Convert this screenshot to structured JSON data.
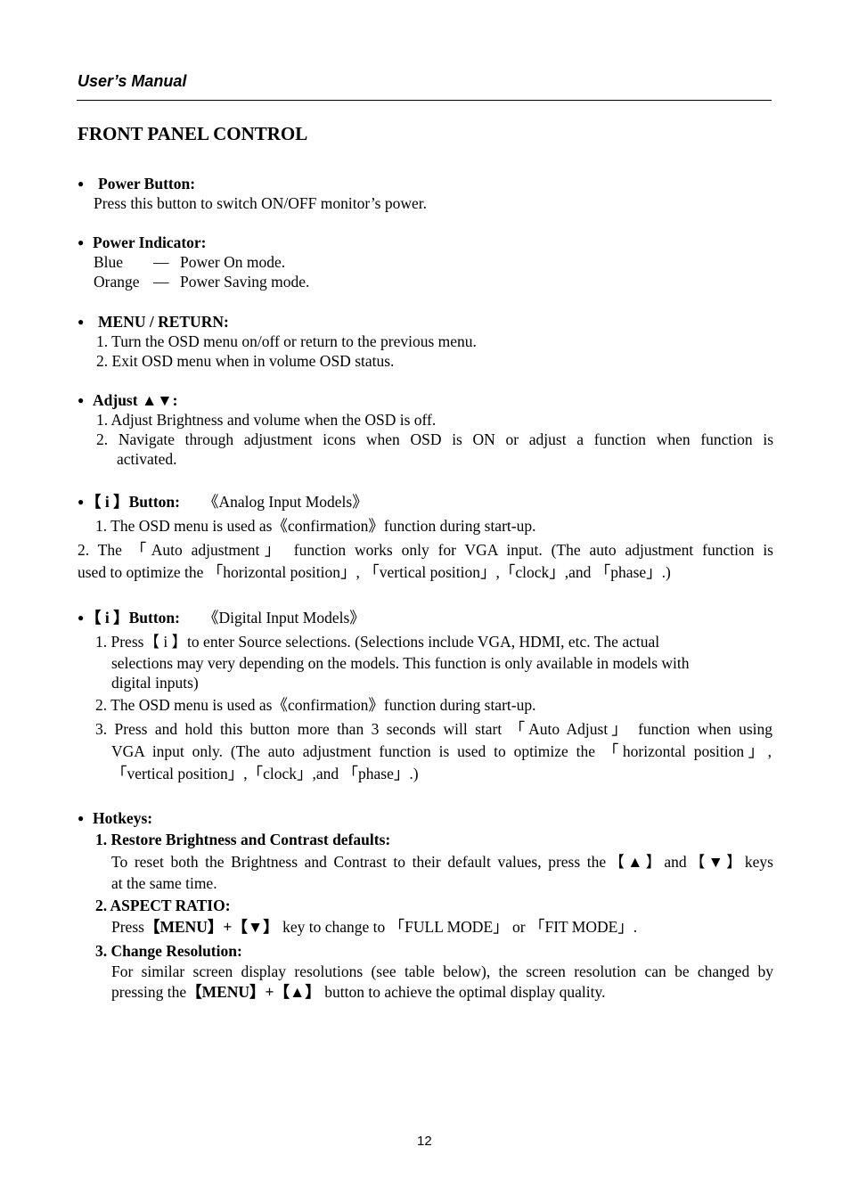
{
  "header": {
    "title": "User’s Manual"
  },
  "page_title": "FRONT PANEL CONTROL",
  "sections": {
    "power_button": {
      "heading": "Power Button:",
      "lines": [
        "Press this button to switch ON/OFF monitor’s power."
      ]
    },
    "power_indicator": {
      "heading": "Power Indicator:",
      "rows": [
        {
          "color": "Blue",
          "dash": "—",
          "mode": "Power On mode."
        },
        {
          "color": "Orange",
          "dash": "—",
          "mode": "Power Saving mode."
        }
      ]
    },
    "menu_return": {
      "heading": "MENU / RETURN:",
      "items": [
        "1. Turn the OSD menu on/off or return to the previous menu.",
        "2. Exit OSD menu when in volume OSD status."
      ]
    },
    "adjust": {
      "heading": "Adjust ▲▼:",
      "items": [
        "1. Adjust Brightness and volume when the OSD is off.",
        "2. Navigate through adjustment icons when OSD is ON or adjust a function when function is",
        "activated."
      ]
    },
    "i_button_analog": {
      "heading": "【 i 】Button:",
      "subtitle": "《Analog Input Models》",
      "items": [
        "1. The OSD menu is used as《confirmation》function during start-up.",
        "2. The 「Auto adjustment」 function works only for VGA input. (The auto adjustment function is",
        "used to optimize the 「horizontal position」, 「vertical position」,「clock」,and 「phase」.)"
      ]
    },
    "i_button_digital": {
      "heading": "【 i 】Button:",
      "subtitle": "《Digital Input Models》",
      "items": [
        "1. Press【 i 】to enter Source selections. (Selections include VGA, HDMI, etc. The actual",
        "selections may very depending on the models. This function is only available in models with",
        "digital inputs)",
        "2. The OSD menu is used as《confirmation》function during start-up.",
        "3. Press and hold this button more than 3 seconds will start 「Auto Adjust」 function when using",
        "VGA input only. (The auto adjustment function is used to optimize the 「horizontal position」,",
        "「vertical position」,「clock」,and 「phase」.)"
      ]
    },
    "hotkeys": {
      "heading": "Hotkeys:",
      "restore": {
        "heading": "1. Restore Brightness and Contrast defaults:",
        "lines": [
          "To reset both the Brightness and Contrast to their default values, press the【▲】and【▼】keys",
          "at the same time."
        ]
      },
      "aspect": {
        "heading": "2. ASPECT RATIO:",
        "pre": "Press",
        "keys": "【MENU】+【▼】",
        "post": "key to change to 「FULL MODE」 or 「FIT MODE」."
      },
      "resolution": {
        "heading": "3. Change Resolution:",
        "line1": "For similar screen display resolutions (see table below), the screen resolution can be changed by",
        "pre": "pressing the",
        "keys": "【MENU】+【▲】",
        "post": "button to achieve the optimal display quality."
      }
    }
  },
  "page_number": "12"
}
